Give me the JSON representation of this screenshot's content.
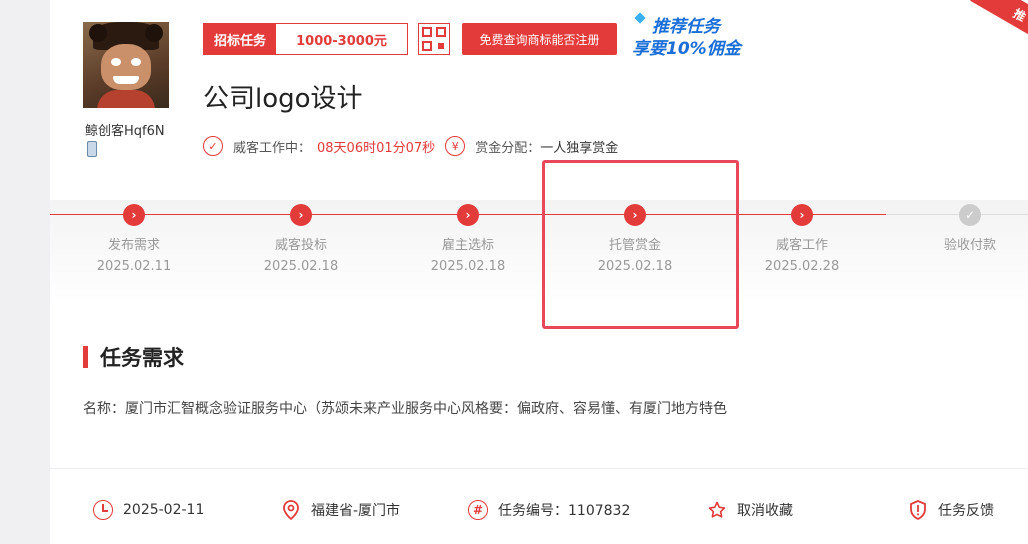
{
  "user": {
    "name": "鲸创客Hqf6N"
  },
  "tag": {
    "label": "招标任务",
    "price": "1000-3000元"
  },
  "query_button": "免费查询商标能否注册",
  "promo": {
    "line1": "推荐任务",
    "line2_prefix": "享要",
    "line2_highlight": "10%佣金"
  },
  "corner_ribbon": "推",
  "title": "公司logo设计",
  "status": {
    "working_label": "威客工作中：",
    "working_time": "08天06时01分07秒",
    "reward_label": "赏金分配：",
    "reward_value": "一人独享赏金"
  },
  "timeline": [
    {
      "name": "发布需求",
      "date": "2025.02.11"
    },
    {
      "name": "威客投标",
      "date": "2025.02.18"
    },
    {
      "name": "雇主选标",
      "date": "2025.02.18"
    },
    {
      "name": "托管赏金",
      "date": "2025.02.18"
    },
    {
      "name": "威客工作",
      "date": "2025.02.28"
    },
    {
      "name": "验收付款",
      "date": ""
    }
  ],
  "section": {
    "title": "任务需求"
  },
  "description": "名称：厦门市汇智概念验证服务中心（苏颂未来产业服务中心风格要：偏政府、容易懂、有厦门地方特色",
  "footer": {
    "date": "2025-02-11",
    "location": "福建省-厦门市",
    "task_no": "任务编号：1107832",
    "favorite": "取消收藏",
    "feedback": "任务反馈"
  },
  "colors": {
    "accent": "#e33a3a",
    "highlight": "#e8485a",
    "promo": "#1a6ed8"
  }
}
